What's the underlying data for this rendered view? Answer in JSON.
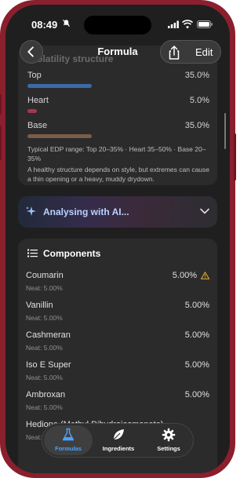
{
  "status_bar": {
    "time": "08:49"
  },
  "nav": {
    "title": "Formula",
    "edit_label": "Edit",
    "ghost_section_title": "Volatility structure"
  },
  "volatility": {
    "rows": [
      {
        "label": "Top",
        "value": "35.0%",
        "color": "#3a6aa8"
      },
      {
        "label": "Heart",
        "value": "5.0%",
        "color": "#a4384a"
      },
      {
        "label": "Base",
        "value": "35.0%",
        "color": "#7a5c48"
      }
    ],
    "range_note": "Typical EDP range: Top 20–35% · Heart 35–50% · Base 20–35%",
    "advice_note": "A healthy structure depends on style, but extremes can cause a thin opening or a heavy, muddy drydown."
  },
  "ai": {
    "label": "Analysing with AI..."
  },
  "components": {
    "title": "Components",
    "items": [
      {
        "name": "Coumarin",
        "sub": "Neat: 5.00%",
        "pct": "5.00%",
        "warning": true
      },
      {
        "name": "Vanillin",
        "sub": "Neat: 5.00%",
        "pct": "5.00%",
        "warning": false
      },
      {
        "name": "Cashmeran",
        "sub": "Neat: 5.00%",
        "pct": "5.00%",
        "warning": false
      },
      {
        "name": "Iso E Super",
        "sub": "Neat: 5.00%",
        "pct": "5.00%",
        "warning": false
      },
      {
        "name": "Ambroxan",
        "sub": "Neat: 5.00%",
        "pct": "5.00%",
        "warning": false
      },
      {
        "name": "Hedione (Methyl Dihydrojasmonate)",
        "sub": "Neat: 5.00%",
        "pct": "",
        "warning": false
      }
    ]
  },
  "tabbar": {
    "tabs": [
      {
        "label": "Formulas",
        "active": true
      },
      {
        "label": "Ingredients",
        "active": false
      },
      {
        "label": "Settings",
        "active": false
      }
    ]
  },
  "colors": {
    "accent": "#4aa3ff",
    "warning": "#e3a22b",
    "frame": "#8a1f2e"
  }
}
